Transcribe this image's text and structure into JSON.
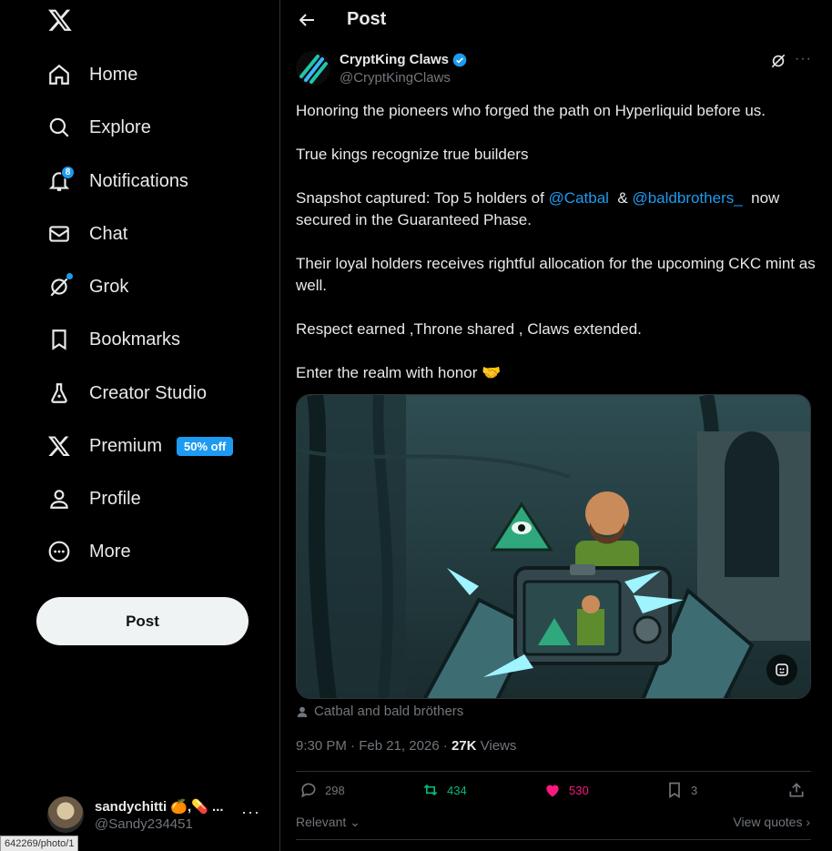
{
  "sidebar": {
    "logo": "x-logo-icon",
    "items": [
      {
        "label": "Home",
        "icon": "home-icon"
      },
      {
        "label": "Explore",
        "icon": "search-icon"
      },
      {
        "label": "Notifications",
        "icon": "bell-icon",
        "badge": "8"
      },
      {
        "label": "Chat",
        "icon": "mail-icon"
      },
      {
        "label": "Grok",
        "icon": "grok-icon"
      },
      {
        "label": "Bookmarks",
        "icon": "bookmark-icon"
      },
      {
        "label": "Creator Studio",
        "icon": "flask-icon"
      },
      {
        "label": "Premium",
        "icon": "x-logo-icon",
        "badge": "50% off"
      },
      {
        "label": "Profile",
        "icon": "person-icon"
      },
      {
        "label": "More",
        "icon": "more-circle-icon"
      }
    ],
    "post_button": "Post",
    "account": {
      "name": "sandychitti 🍊,💊 ...",
      "handle": "@Sandy234451",
      "more": "···"
    },
    "status_url": "642269/photo/1"
  },
  "header": {
    "title": "Post"
  },
  "tweet": {
    "author_name": "CryptKing Claws",
    "author_handle": "@CryptKingClaws",
    "paragraphs": {
      "p1": "Honoring the pioneers who forged the path on Hyperliquid before us.",
      "p2": "True kings recognize true builders",
      "p3_pre": "Snapshot captured: Top 5 holders of ",
      "mention1": "@Catbal",
      "p3_mid": "  & ",
      "mention2": "@baldbrothers_",
      "p3_post": "  now secured in the Guaranteed Phase.",
      "p4": "Their loyal holders receives rightful allocation for the upcoming CKC mint as well.",
      "p5": "Respect earned ,Throne shared , Claws extended.",
      "p6": "Enter the realm with honor 🤝"
    },
    "tagged": "Catbal and bald bröthers",
    "time": "9:30 PM · Feb 21, 2026 · ",
    "views_count": "27K",
    "views_label": " Views",
    "actions": {
      "replies": "298",
      "reposts": "434",
      "likes": "530",
      "bookmarks": "3"
    },
    "sort_label": "Relevant",
    "view_quotes": "View quotes"
  },
  "colors": {
    "accent": "#1d9bf0",
    "repost": "#00ba7c",
    "like": "#f91880",
    "muted": "#71767b",
    "text": "#e7e9ea"
  }
}
